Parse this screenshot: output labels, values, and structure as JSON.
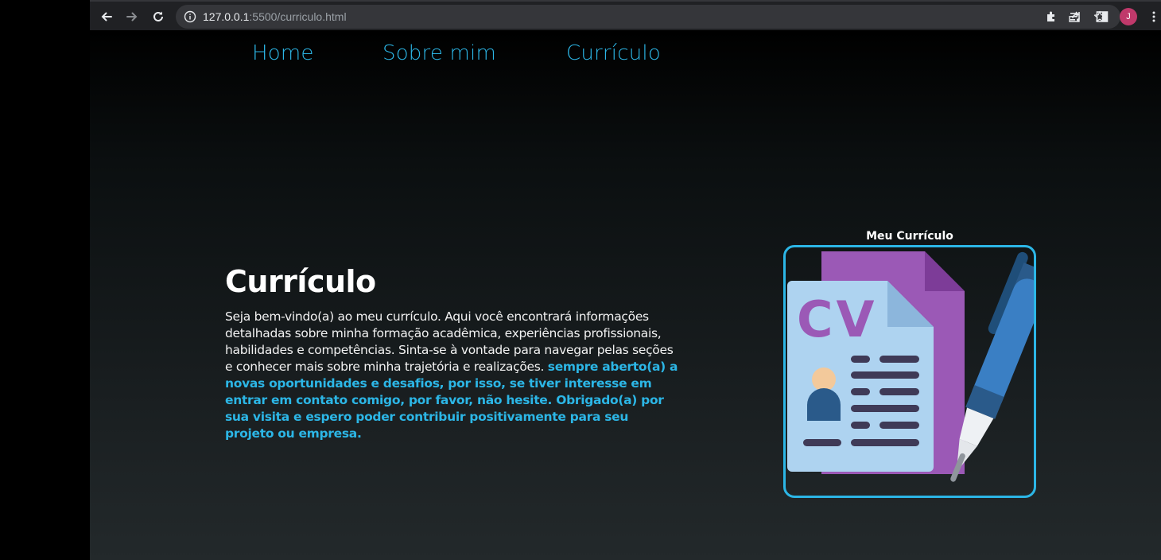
{
  "browser": {
    "url_host": "127.0.0.1",
    "url_rest": ":5500/curriculo.html",
    "profile_initial": "J"
  },
  "nav": {
    "items": [
      "Home",
      "Sobre mim",
      "Currículo"
    ]
  },
  "main": {
    "title": "Currículo",
    "intro_text": "Seja bem-vindo(a) ao meu currículo. Aqui você encontrará informações detalhadas sobre minha formação acadêmica, experiências profissionais, habilidades e competências. Sinta-se à vontade para navegar pelas seções e conhecer mais sobre minha trajetória e realizações. ",
    "highlight_text": "sempre aberto(a) a novas oportunidades e desafios, por isso, se tiver interesse em entrar em contato comigo, por favor, não hesite. Obrigado(a) por sua visita e espero poder contribuir positivamente para seu projeto ou empresa."
  },
  "cv_card": {
    "caption": "Meu Currículo",
    "image_text": "CV"
  },
  "colors": {
    "accent": "#2cb6e6",
    "text": "#ffffff",
    "avatar": "#c0396b"
  },
  "icons": [
    "back-arrow-icon",
    "forward-arrow-icon",
    "reload-icon",
    "info-icon",
    "share-icon",
    "star-icon",
    "extensions-icon",
    "media-icon",
    "side-panel-icon",
    "menu-dots-icon"
  ]
}
